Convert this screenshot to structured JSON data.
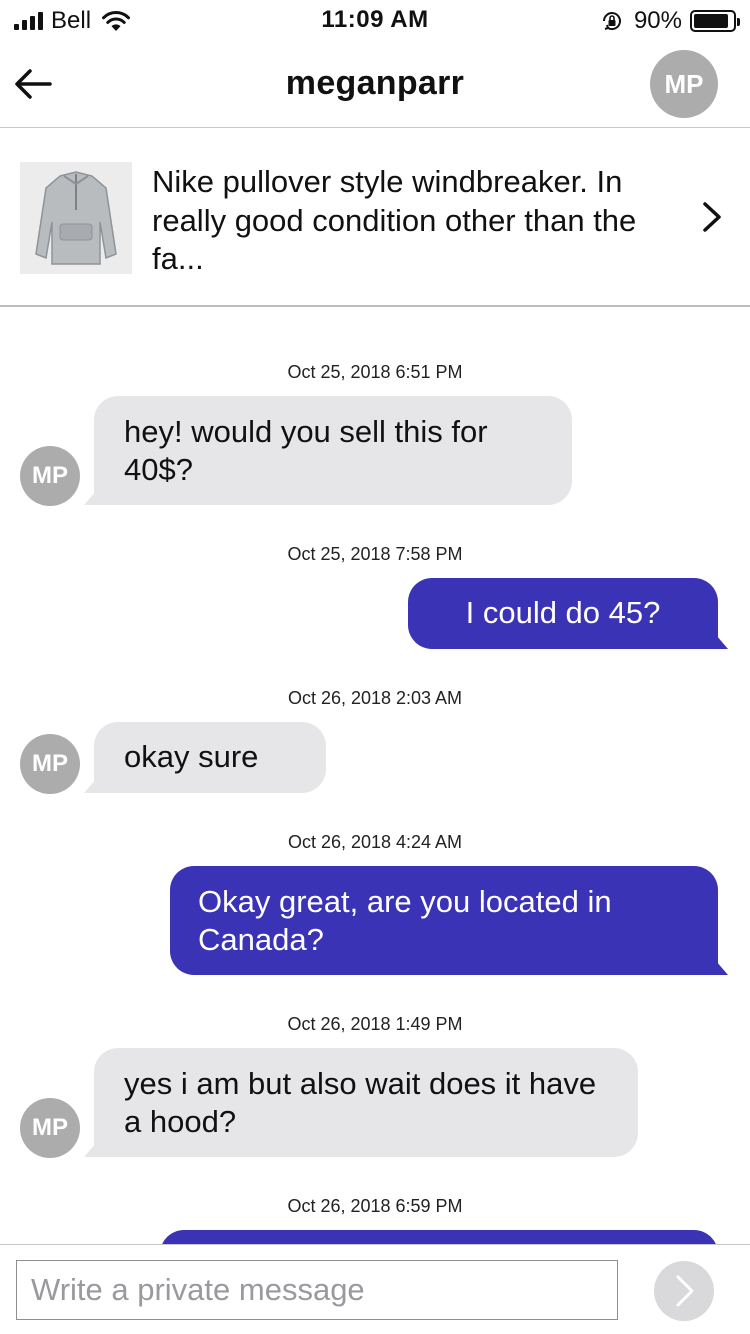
{
  "status_bar": {
    "carrier": "Bell",
    "time": "11:09 AM",
    "battery_percent": "90%",
    "battery_level": 0.9,
    "icons": [
      "signal-icon",
      "wifi-icon",
      "rotation-lock-icon",
      "battery-icon"
    ]
  },
  "header": {
    "back_icon": "back-arrow-icon",
    "title": "meganparr",
    "avatar_initials": "MP"
  },
  "listing": {
    "description": "Nike pullover style windbreaker. In really good condition other than the fa...",
    "chevron_icon": "chevron-right-icon",
    "image": "windbreaker-jacket-photo"
  },
  "messages": [
    {
      "timestamp": "Oct 25, 2018 6:51 PM",
      "direction": "incoming",
      "avatar": "MP",
      "text": "hey! would you sell this for 40$?"
    },
    {
      "timestamp": "Oct 25, 2018 7:58 PM",
      "direction": "outgoing",
      "text": "I could do 45?"
    },
    {
      "timestamp": "Oct 26, 2018 2:03 AM",
      "direction": "incoming",
      "avatar": "MP",
      "text": "okay sure"
    },
    {
      "timestamp": "Oct 26, 2018 4:24 AM",
      "direction": "outgoing",
      "text": "Okay great, are you located in Canada?"
    },
    {
      "timestamp": "Oct 26, 2018 1:49 PM",
      "direction": "incoming",
      "avatar": "MP",
      "text": "yes i am but also wait does it have a hood?"
    },
    {
      "timestamp": "Oct 26, 2018 6:59 PM",
      "direction": "outgoing",
      "text": ""
    }
  ],
  "composer": {
    "placeholder": "Write a private message",
    "send_icon": "send-arrow-icon"
  },
  "colors": {
    "outgoing_bubble": "#3b33b6",
    "incoming_bubble": "#e6e6e8",
    "avatar": "#acacac"
  }
}
